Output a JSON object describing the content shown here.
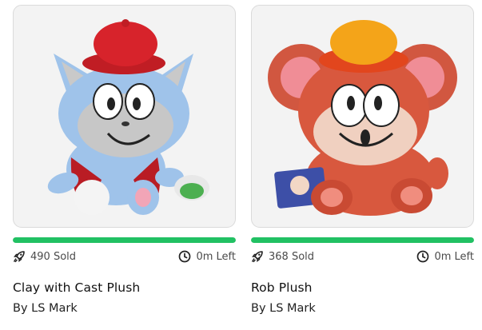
{
  "products": [
    {
      "title": "Clay with Cast Plush",
      "byline": "By LS Mark",
      "sold": "490 Sold",
      "time_left": "0m Left",
      "progress_fraction": 1.0,
      "icons": {
        "sold": "rocket-icon",
        "time": "clock-icon"
      },
      "image": "blue cat plush with red cap"
    },
    {
      "title": "Rob Plush",
      "byline": "By LS Mark",
      "sold": "368 Sold",
      "time_left": "0m Left",
      "progress_fraction": 1.0,
      "icons": {
        "sold": "rocket-icon",
        "time": "clock-icon"
      },
      "image": "orange bear plush with yellow cap"
    }
  ],
  "colors": {
    "progress": "#21c163",
    "track": "#e6e6e6",
    "card_bg": "#f3f3f3"
  }
}
